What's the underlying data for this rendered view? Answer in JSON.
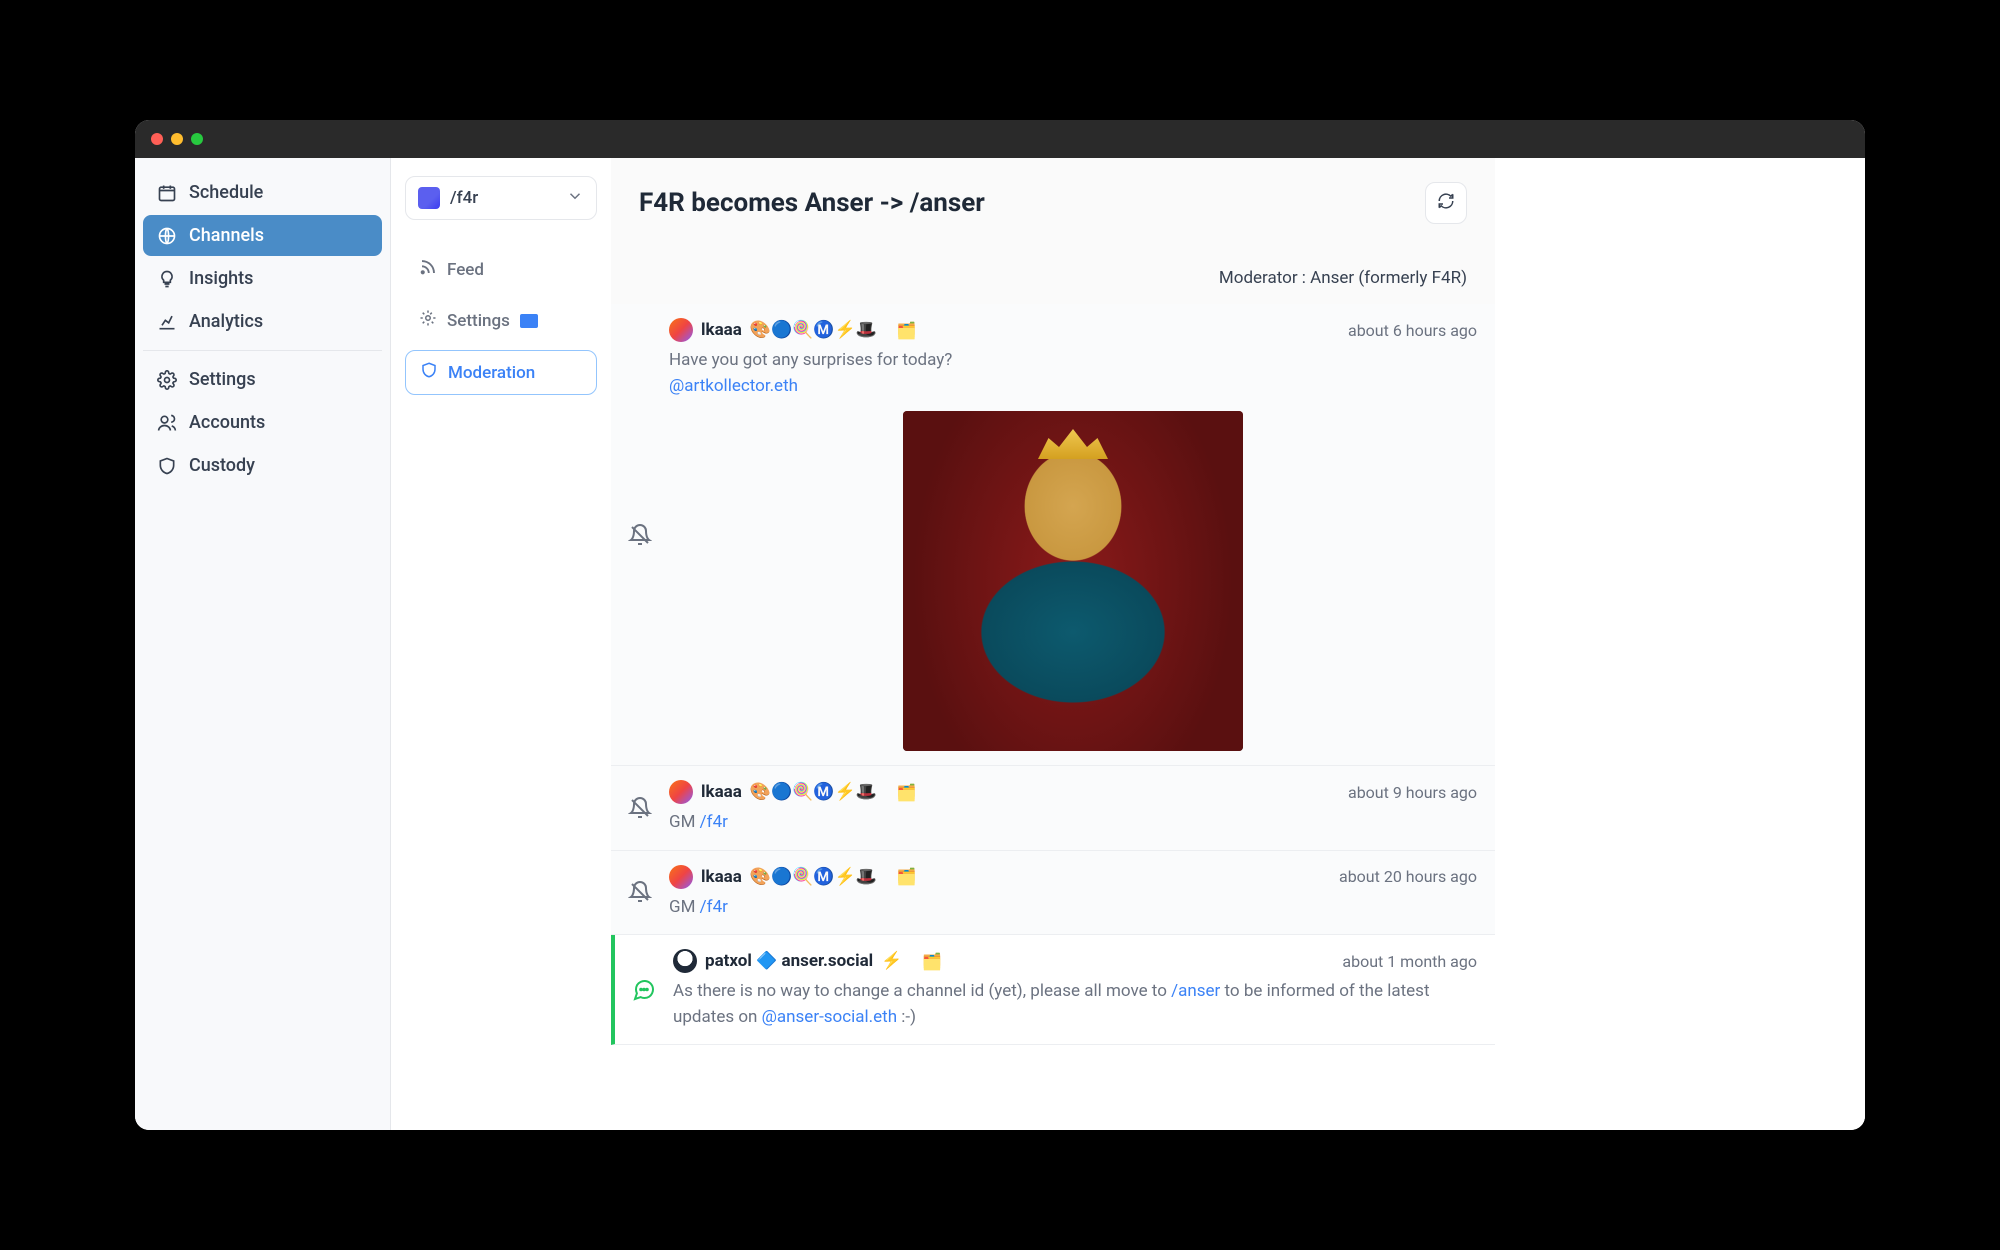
{
  "titlebar": {
    "buttons": [
      "close",
      "minimize",
      "zoom"
    ]
  },
  "sidebar": {
    "items": [
      {
        "id": "schedule",
        "label": "Schedule",
        "icon": "calendar",
        "active": false
      },
      {
        "id": "channels",
        "label": "Channels",
        "icon": "globe",
        "active": true
      },
      {
        "id": "insights",
        "label": "Insights",
        "icon": "bulb",
        "active": false
      },
      {
        "id": "analytics",
        "label": "Analytics",
        "icon": "chart",
        "active": false
      }
    ],
    "items2": [
      {
        "id": "settings",
        "label": "Settings",
        "icon": "gear",
        "active": false
      },
      {
        "id": "accounts",
        "label": "Accounts",
        "icon": "users",
        "active": false
      },
      {
        "id": "custody",
        "label": "Custody",
        "icon": "shield",
        "active": false
      }
    ]
  },
  "subnav": {
    "channel": "/f4r",
    "items": [
      {
        "id": "feed",
        "label": "Feed",
        "icon": "rss",
        "active": false,
        "badge": false
      },
      {
        "id": "settings",
        "label": "Settings",
        "icon": "gear",
        "active": false,
        "badge": true
      },
      {
        "id": "moderation",
        "label": "Moderation",
        "icon": "shield",
        "active": true,
        "badge": false
      }
    ]
  },
  "main": {
    "title": "F4R becomes Anser -> /anser",
    "moderator_label": "Moderator :  ",
    "moderator_value": "Anser (formerly F4R)"
  },
  "posts": [
    {
      "user": "lkaaa",
      "avatar_kind": "lkaaa",
      "badges": "🎨🔵🍭Ⓜ️⚡🎩",
      "folder": "🗂️",
      "timestamp": "about 6 hours ago",
      "text_prefix": "Have you got any surprises for today?",
      "mention": "@artkollector.eth",
      "text_tail": "",
      "channel_link": "",
      "mention2": "",
      "text_tail2": "",
      "has_image": true,
      "muted": true,
      "highlighted": false,
      "gutter_valign": "center"
    },
    {
      "user": "lkaaa",
      "avatar_kind": "lkaaa",
      "badges": "🎨🔵🍭Ⓜ️⚡🎩",
      "folder": "🗂️",
      "timestamp": "about 9 hours ago",
      "text_prefix": "GM ",
      "mention": "/f4r",
      "text_tail": "",
      "channel_link": "",
      "mention2": "",
      "text_tail2": "",
      "has_image": false,
      "muted": true,
      "highlighted": false,
      "gutter_valign": "center"
    },
    {
      "user": "lkaaa",
      "avatar_kind": "lkaaa",
      "badges": "🎨🔵🍭Ⓜ️⚡🎩",
      "folder": "🗂️",
      "timestamp": "about 20 hours ago",
      "text_prefix": "GM ",
      "mention": "/f4r",
      "text_tail": "",
      "channel_link": "",
      "mention2": "",
      "text_tail2": "",
      "has_image": false,
      "muted": true,
      "highlighted": false,
      "gutter_valign": "center"
    },
    {
      "user": "patxol 🔷 anser.social",
      "avatar_kind": "patxol",
      "badges": "⚡",
      "folder": "🗂️",
      "timestamp": "about 1 month ago",
      "text_prefix": "As there is no way to change a channel id (yet), please all move to ",
      "mention": "/anser",
      "text_tail": " to be informed of the latest updates on ",
      "mention2": "@anser-social.eth",
      "text_tail2": " :-)",
      "has_image": false,
      "muted": false,
      "highlighted": true,
      "gutter_valign": "center"
    }
  ]
}
